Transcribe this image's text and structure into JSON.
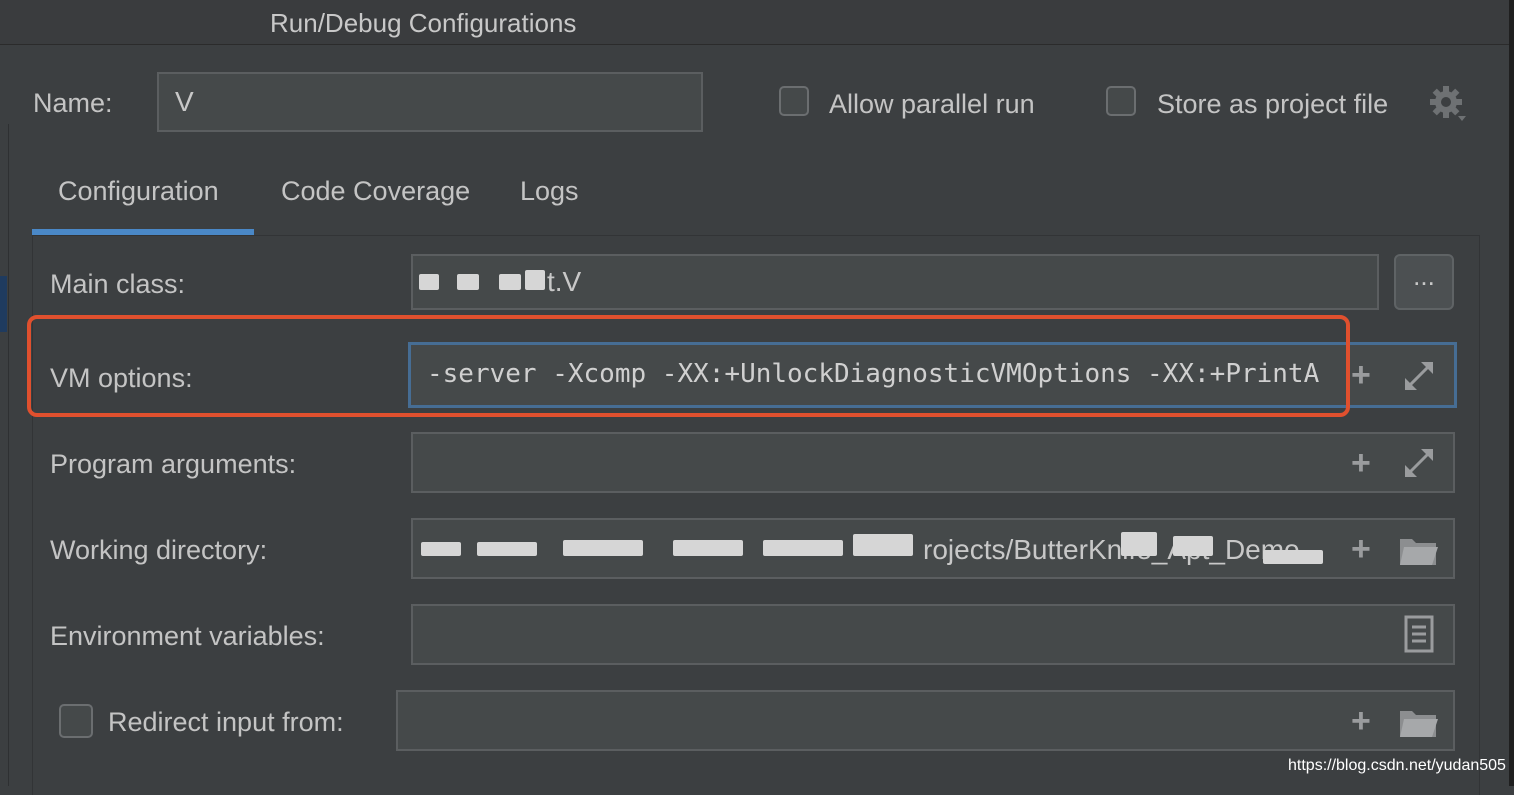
{
  "window": {
    "title": "Run/Debug Configurations"
  },
  "name_row": {
    "label": "Name:",
    "value": "V",
    "allow_parallel_label": "Allow parallel run",
    "allow_parallel_checked": false,
    "store_project_label": "Store as project file",
    "store_project_checked": false
  },
  "tabs": [
    {
      "label": "Configuration",
      "active": true
    },
    {
      "label": "Code Coverage",
      "active": false
    },
    {
      "label": "Logs",
      "active": false
    }
  ],
  "form": {
    "main_class": {
      "label": "Main class:",
      "value_visible": "t.V",
      "button": "..."
    },
    "vm_options": {
      "label": "VM options:",
      "value": "-server -Xcomp -XX:+UnlockDiagnosticVMOptions -XX:+PrintA"
    },
    "program_arguments": {
      "label": "Program arguments:",
      "value": ""
    },
    "working_directory": {
      "label": "Working directory:",
      "value_visible": "rojects/ButterKnife_Apt_Demo"
    },
    "environment_variables": {
      "label": "Environment variables:",
      "value": ""
    },
    "redirect_input": {
      "label": "Redirect input from:",
      "checked": false,
      "value": ""
    }
  },
  "icons": {
    "settings": "gear-icon",
    "insert_macro": "plus-icon",
    "expand": "expand-icon",
    "browse_folder": "folder-icon",
    "edit_env": "document-icon"
  },
  "colors": {
    "accent": "#4a88c7",
    "highlight": "#e0502e",
    "background": "#3c3f41",
    "field": "#45494a"
  },
  "watermark": "https://blog.csdn.net/yudan505"
}
